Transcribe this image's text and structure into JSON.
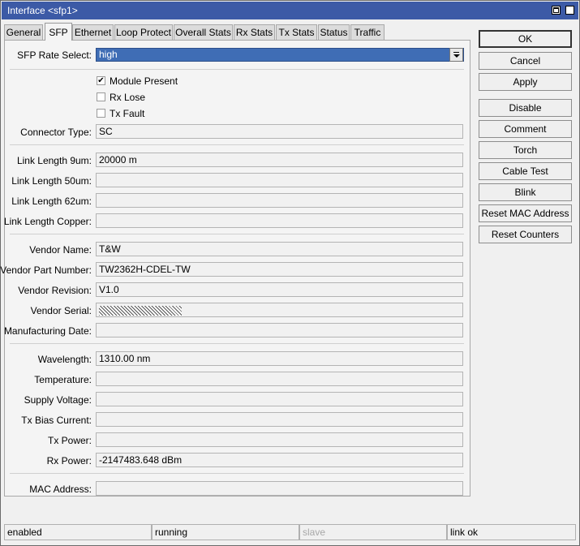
{
  "window": {
    "title": "Interface <sfp1>",
    "maximize_icon": "maximize-icon",
    "close_icon": "close-icon",
    "close_glyph": "×"
  },
  "tabs": [
    "General",
    "SFP",
    "Ethernet",
    "Loop Protect",
    "Overall Stats",
    "Rx Stats",
    "Tx Stats",
    "Status",
    "Traffic"
  ],
  "active_tab": "SFP",
  "sfp": {
    "rate_select": {
      "label": "SFP Rate Select:",
      "value": "high"
    },
    "checkboxes": [
      {
        "label": "Module Present",
        "checked": true,
        "mark": "✔"
      },
      {
        "label": "Rx Lose",
        "checked": false,
        "mark": ""
      },
      {
        "label": "Tx Fault",
        "checked": false,
        "mark": ""
      }
    ],
    "connector_type": {
      "label": "Connector Type:",
      "value": "SC"
    },
    "link_length_9um": {
      "label": "Link Length 9um:",
      "value": "20000 m"
    },
    "link_length_50um": {
      "label": "Link Length 50um:",
      "value": ""
    },
    "link_length_62um": {
      "label": "Link Length 62um:",
      "value": ""
    },
    "link_length_copper": {
      "label": "Link Length Copper:",
      "value": ""
    },
    "vendor_name": {
      "label": "Vendor Name:",
      "value": "T&W"
    },
    "vendor_part_number": {
      "label": "Vendor Part Number:",
      "value": "TW2362H-CDEL-TW"
    },
    "vendor_revision": {
      "label": "Vendor Revision:",
      "value": "V1.0"
    },
    "vendor_serial": {
      "label": "Vendor Serial:",
      "value": ""
    },
    "manufacturing_date": {
      "label": "Manufacturing Date:",
      "value": ""
    },
    "wavelength": {
      "label": "Wavelength:",
      "value": "1310.00 nm"
    },
    "temperature": {
      "label": "Temperature:",
      "value": ""
    },
    "supply_voltage": {
      "label": "Supply Voltage:",
      "value": ""
    },
    "tx_bias_current": {
      "label": "Tx Bias Current:",
      "value": ""
    },
    "tx_power": {
      "label": "Tx Power:",
      "value": ""
    },
    "rx_power": {
      "label": "Rx Power:",
      "value": "-2147483.648 dBm"
    },
    "mac_address": {
      "label": "MAC Address:",
      "value": ""
    }
  },
  "buttons": [
    "OK",
    "Cancel",
    "Apply",
    "Disable",
    "Comment",
    "Torch",
    "Cable Test",
    "Blink",
    "Reset MAC Address",
    "Reset Counters"
  ],
  "statusbar": [
    "enabled",
    "running",
    "slave",
    "link ok"
  ],
  "colors": {
    "titlebar": "#3c5aa6",
    "select_bg": "#3f6db5"
  }
}
